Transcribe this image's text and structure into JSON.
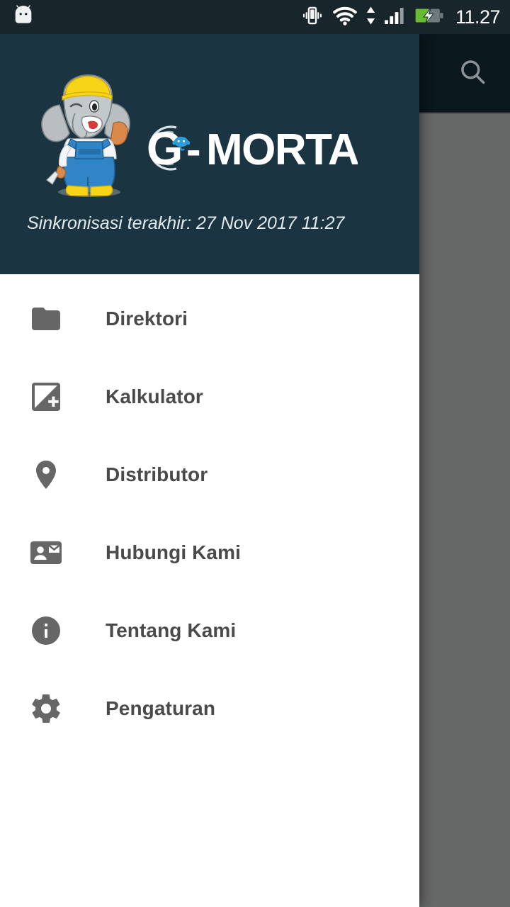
{
  "status_bar": {
    "notification_icon": "android-head-icon",
    "icons": [
      "vibrate-icon",
      "wifi-icon",
      "data-transfer-arrows-icon",
      "cellular-signal-icon",
      "battery-charging-icon"
    ],
    "clock": "11.27",
    "background_color": "#18252b",
    "text_color": "#ffffff"
  },
  "behind_activity": {
    "toolbar": {
      "search_icon": "search-icon",
      "background_color": "#0a171c"
    },
    "scrim_color": "#666767"
  },
  "drawer": {
    "background_color": "#ffffff",
    "header": {
      "background_color": "#1a3541",
      "mascot_alt": "elephant-mascot-icon",
      "brand_name": "G-MORTAR",
      "brand_mark_letter": "G",
      "brand_separator": "-",
      "brand_rest": "MORTAR",
      "sync_label": "Sinkronisasi terakhir: 27 Nov 2017 11:27",
      "sync_text_color": "#e3ebee"
    },
    "items": [
      {
        "label": "Direktori",
        "icon": "folder-icon"
      },
      {
        "label": "Kalkulator",
        "icon": "exposure-calculator-icon"
      },
      {
        "label": "Distributor",
        "icon": "location-pin-icon"
      },
      {
        "label": "Hubungi Kami",
        "icon": "contact-mail-icon"
      },
      {
        "label": "Tentang Kami",
        "icon": "info-circle-icon"
      },
      {
        "label": "Pengaturan",
        "icon": "gear-icon"
      }
    ],
    "item_icon_color": "#666666",
    "item_text_color": "#4a4a4a"
  }
}
